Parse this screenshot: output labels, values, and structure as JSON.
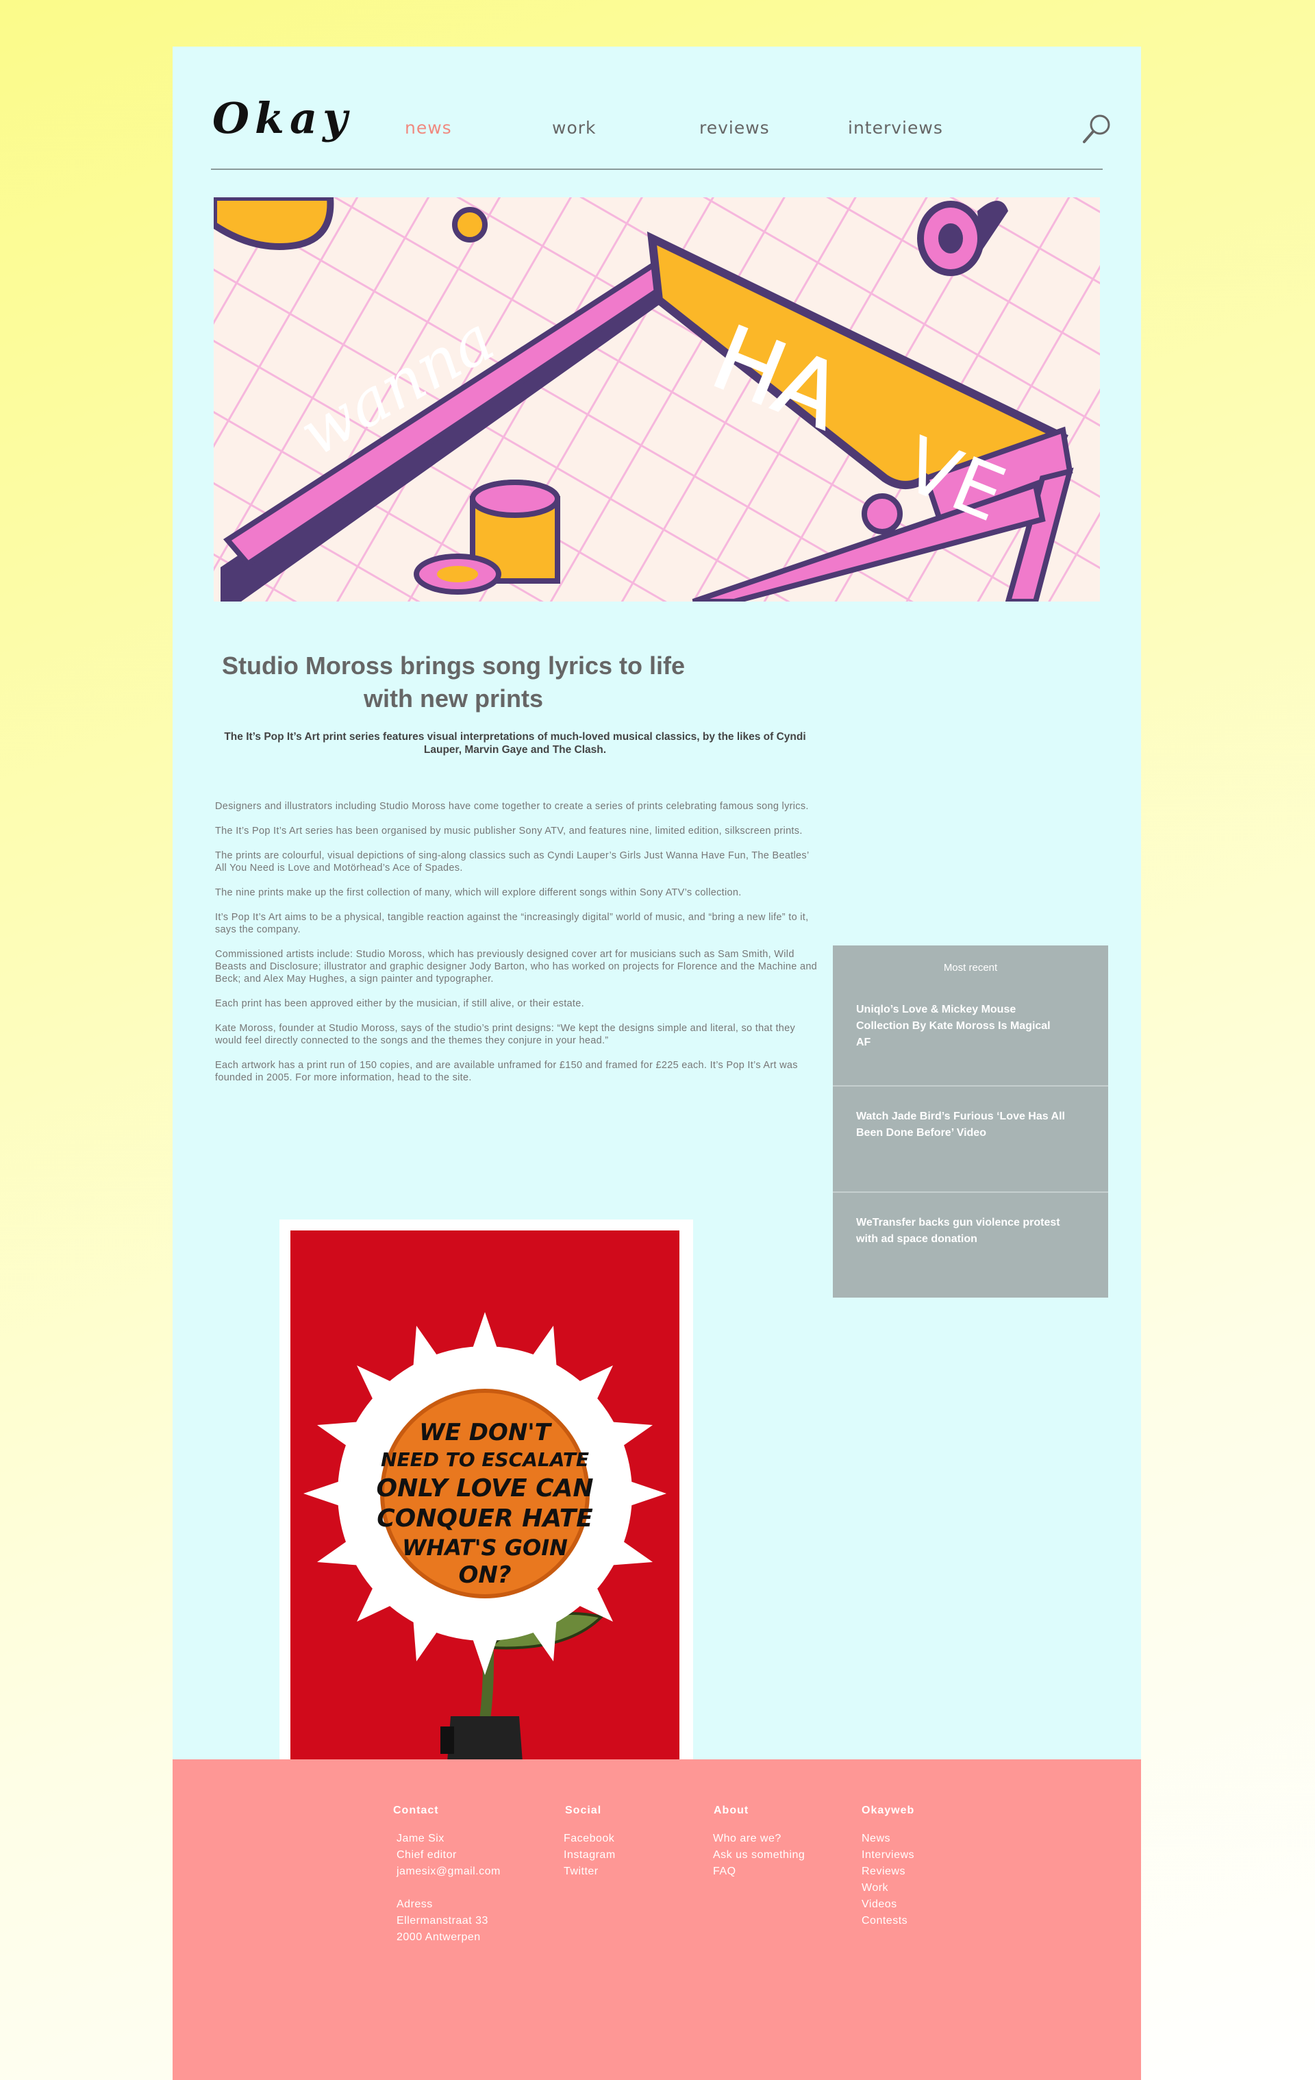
{
  "header": {
    "logo": "Okay",
    "nav": [
      {
        "label": "news",
        "active": true
      },
      {
        "label": "work",
        "active": false
      },
      {
        "label": "reviews",
        "active": false
      },
      {
        "label": "interviews",
        "active": false
      }
    ],
    "search_icon": "search-icon"
  },
  "hero": {
    "lettering": [
      "wanna",
      "HA",
      "VE"
    ],
    "colors": {
      "pink": "#f07acb",
      "gold": "#fbb728",
      "purple": "#4e3a73",
      "grid": "#f5b0dc",
      "bg": "#fdf1ea"
    }
  },
  "article": {
    "title": "Studio Moross brings song lyrics to life with new prints",
    "subtitle": "The It’s Pop It’s Art print series features visual interpretations of much-loved musical classics, by the likes of Cyndi Lauper, Marvin Gaye and The Clash.",
    "paragraphs": [
      "Designers and illustrators including Studio Moross have come together to create a series of prints celebrating famous song lyrics.",
      "The It’s Pop It’s Art series has been organised by music publisher Sony ATV, and features nine, limited edition, silkscreen prints.",
      "The prints are colourful, visual depictions of sing-along classics such as Cyndi Lauper’s Girls Just Wanna Have Fun, The Beatles’ All You Need is Love and Motörhead’s Ace of Spades.",
      "The nine prints make up the first collection of many, which will explore different songs within Sony ATV’s collection.",
      "It’s Pop It’s Art aims to be a physical, tangible reaction against the “increasingly digital” world of music, and “bring a new life” to it, says the company.",
      "Commissioned artists include: Studio Moross, which has previously designed cover art for musicians such as Sam Smith, Wild Beasts and Disclosure; illustrator and graphic designer Jody Barton, who has worked on projects for Florence and the Machine and Beck; and Alex May Hughes, a sign painter and typographer.",
      "Each print has been approved either by the musician, if still alive, or their estate.",
      "Kate Moross, founder at Studio Moross, says of the studio’s print designs: “We kept the designs simple and literal, so that they would feel directly connected to the songs and the themes they conjure in your head.”",
      "Each artwork has a print run of 150 copies, and are available unframed for £150 and framed for £225 each. It’s Pop It’s Art was founded in 2005. For more information, head to the site."
    ],
    "poster_lines": [
      "WE DON'T",
      "NEED TO ESCALATE",
      "ONLY LOVE CAN",
      "CONQUER HATE",
      "WHAT'S GOIN",
      "ON?"
    ]
  },
  "sidebar": {
    "title": "Most recent",
    "items": [
      "Uniqlo’s Love & Mickey Mouse Collection By Kate Moross Is Magical AF",
      "Watch Jade Bird’s Furious ‘Love Has All Been Done Before’ Video",
      "WeTransfer backs gun violence protest with ad space donation"
    ]
  },
  "footer": {
    "contact": {
      "heading": "Contact",
      "lines": [
        "Jame Six",
        "Chief editor",
        "jamesix@gmail.com"
      ],
      "address": [
        "Adress",
        "Ellermanstraat 33",
        "2000 Antwerpen"
      ]
    },
    "social": {
      "heading": "Social",
      "links": [
        "Facebook",
        "Instagram",
        "Twitter"
      ]
    },
    "about": {
      "heading": "About",
      "links": [
        "Who are we?",
        "Ask us something",
        "FAQ"
      ]
    },
    "okayweb": {
      "heading": "Okayweb",
      "links": [
        "News",
        "Interviews",
        "Reviews",
        "Work",
        "Videos",
        "Contests"
      ]
    }
  }
}
